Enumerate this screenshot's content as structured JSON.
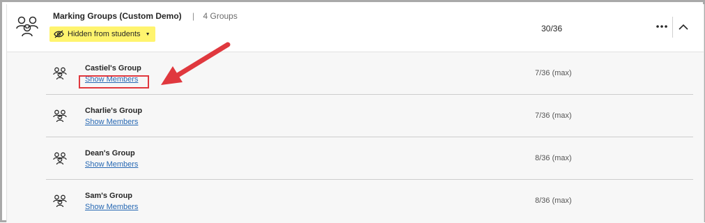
{
  "header": {
    "title": "Marking Groups (Custom Demo)",
    "separator": "|",
    "group_count": "4 Groups",
    "visibility_label": "Hidden from students",
    "visibility_caret": "▼",
    "total_members": "30/36"
  },
  "groups": [
    {
      "name": "Castiel's Group",
      "link_label": "Show Members",
      "capacity": "7/36 (max)"
    },
    {
      "name": "Charlie's Group",
      "link_label": "Show Members",
      "capacity": "7/36 (max)"
    },
    {
      "name": "Dean's Group",
      "link_label": "Show Members",
      "capacity": "8/36 (max)"
    },
    {
      "name": "Sam's Group",
      "link_label": "Show Members",
      "capacity": "8/36 (max)"
    }
  ],
  "icons": {
    "header": "group-icon",
    "visibility": "eye-slash-icon",
    "more": "more-options-icon",
    "collapse": "chevron-up-icon",
    "row": "group-icon"
  },
  "colors": {
    "badge": "#fff46e",
    "link": "#2768b3",
    "annotation": "#e0383e"
  }
}
